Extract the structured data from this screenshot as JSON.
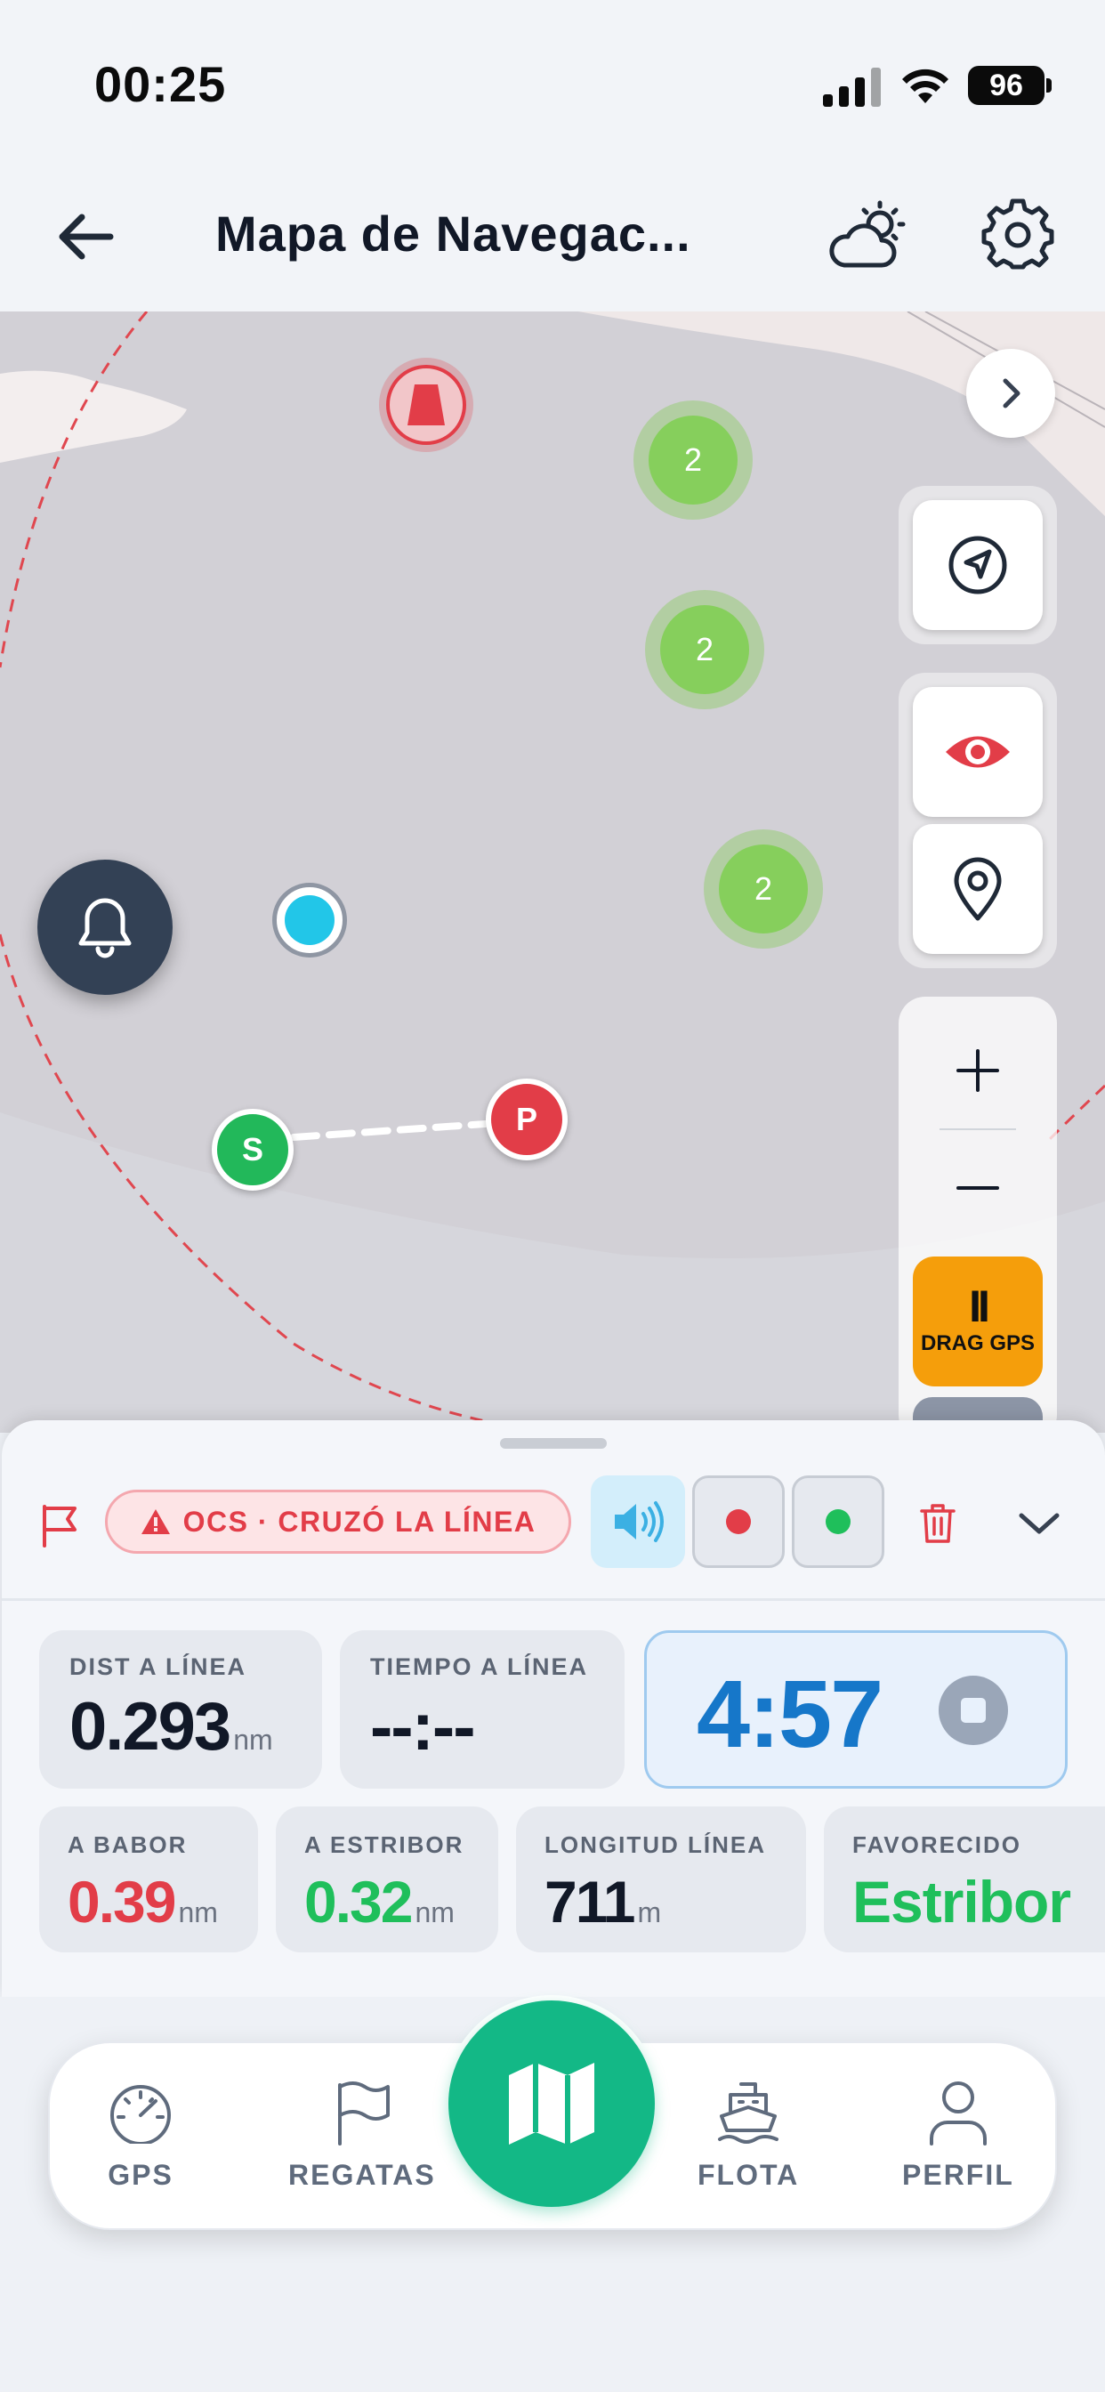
{
  "status_bar": {
    "time": "00:25",
    "battery": "96"
  },
  "header": {
    "title": "Mapa de Navegac...",
    "back_icon": "back-arrow-icon",
    "weather_icon": "weather-partly-cloudy-icon",
    "settings_icon": "gear-icon"
  },
  "map": {
    "clusters": [
      {
        "count": "2"
      },
      {
        "count": "2"
      },
      {
        "count": "2"
      }
    ],
    "start_marker": "S",
    "pin_marker": "P",
    "drag_gps": {
      "icon": "II",
      "label": "DRAG GPS"
    }
  },
  "sheet": {
    "ocs_badge": "OCS · CRUZÓ LA LÍNEA",
    "colors": {
      "alert_red": "#e23d48",
      "port_red": "#e23d48",
      "starboard_green": "#1fbf5b",
      "timer_blue": "#1677c9",
      "accent_green": "#13b886"
    },
    "stats": {
      "dist_label": "DIST A LÍNEA",
      "dist_value": "0.293",
      "dist_unit": "nm",
      "time_label": "TIEMPO A LÍNEA",
      "time_value": "--:--",
      "timer_value": "4:57",
      "babor_label": "A BABOR",
      "babor_value": "0.39",
      "babor_unit": "nm",
      "estribor_label": "A ESTRIBOR",
      "estribor_value": "0.32",
      "estribor_unit": "nm",
      "longitud_label": "LONGITUD LÍNEA",
      "longitud_value": "711",
      "longitud_unit": "m",
      "favorecido_label": "FAVORECIDO",
      "favorecido_value": "Estribor"
    }
  },
  "tabbar": {
    "tabs": [
      {
        "label": "GPS",
        "icon": "speedometer-icon"
      },
      {
        "label": "REGATAS",
        "icon": "flag-icon"
      },
      {
        "label": "",
        "icon": "map-icon"
      },
      {
        "label": "FLOTA",
        "icon": "ship-icon"
      },
      {
        "label": "PERFIL",
        "icon": "user-icon"
      }
    ]
  }
}
